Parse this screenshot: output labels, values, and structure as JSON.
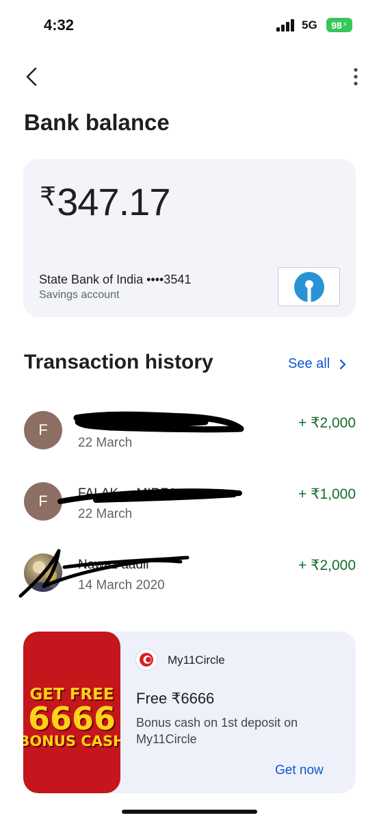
{
  "status_bar": {
    "time": "4:32",
    "network": "5G",
    "battery": "98"
  },
  "app_bar": {
    "back_icon": "chevron-left-icon",
    "more_icon": "more-vert-icon"
  },
  "page": {
    "title": "Bank balance"
  },
  "balance_card": {
    "currency": "₹",
    "amount": "347.17",
    "bank_name": "State Bank of India ••••3541",
    "account_type": "Savings account",
    "bank_logo": "sbi-logo"
  },
  "transactions": {
    "title": "Transaction history",
    "see_all": "See all",
    "items": [
      {
        "avatar": "F",
        "name": "FALAK ... MIRZA",
        "date": "22 March",
        "amount": "+ ₹2,000"
      },
      {
        "avatar": "F",
        "name": "FALAK ... MIRZA",
        "date": "22 March",
        "amount": "+ ₹1,000"
      },
      {
        "avatar": "",
        "name": "Nawaz aadil",
        "date": "14 March 2020",
        "amount": "+ ₹2,000"
      }
    ]
  },
  "promo": {
    "image_lines": [
      "GET FREE",
      "6666",
      "BONUS CASH"
    ],
    "brand": "My11Circle",
    "title": "Free ₹6666",
    "description": "Bonus cash on 1st deposit on My11Circle",
    "cta": "Get now"
  },
  "colors": {
    "accent": "#0b57d0",
    "credit_green": "#146c2e",
    "card_bg": "#f2f4fa",
    "avatar_brown": "#8d6e63",
    "sbi_blue": "#2a93d5",
    "promo_red": "#c4161c"
  }
}
